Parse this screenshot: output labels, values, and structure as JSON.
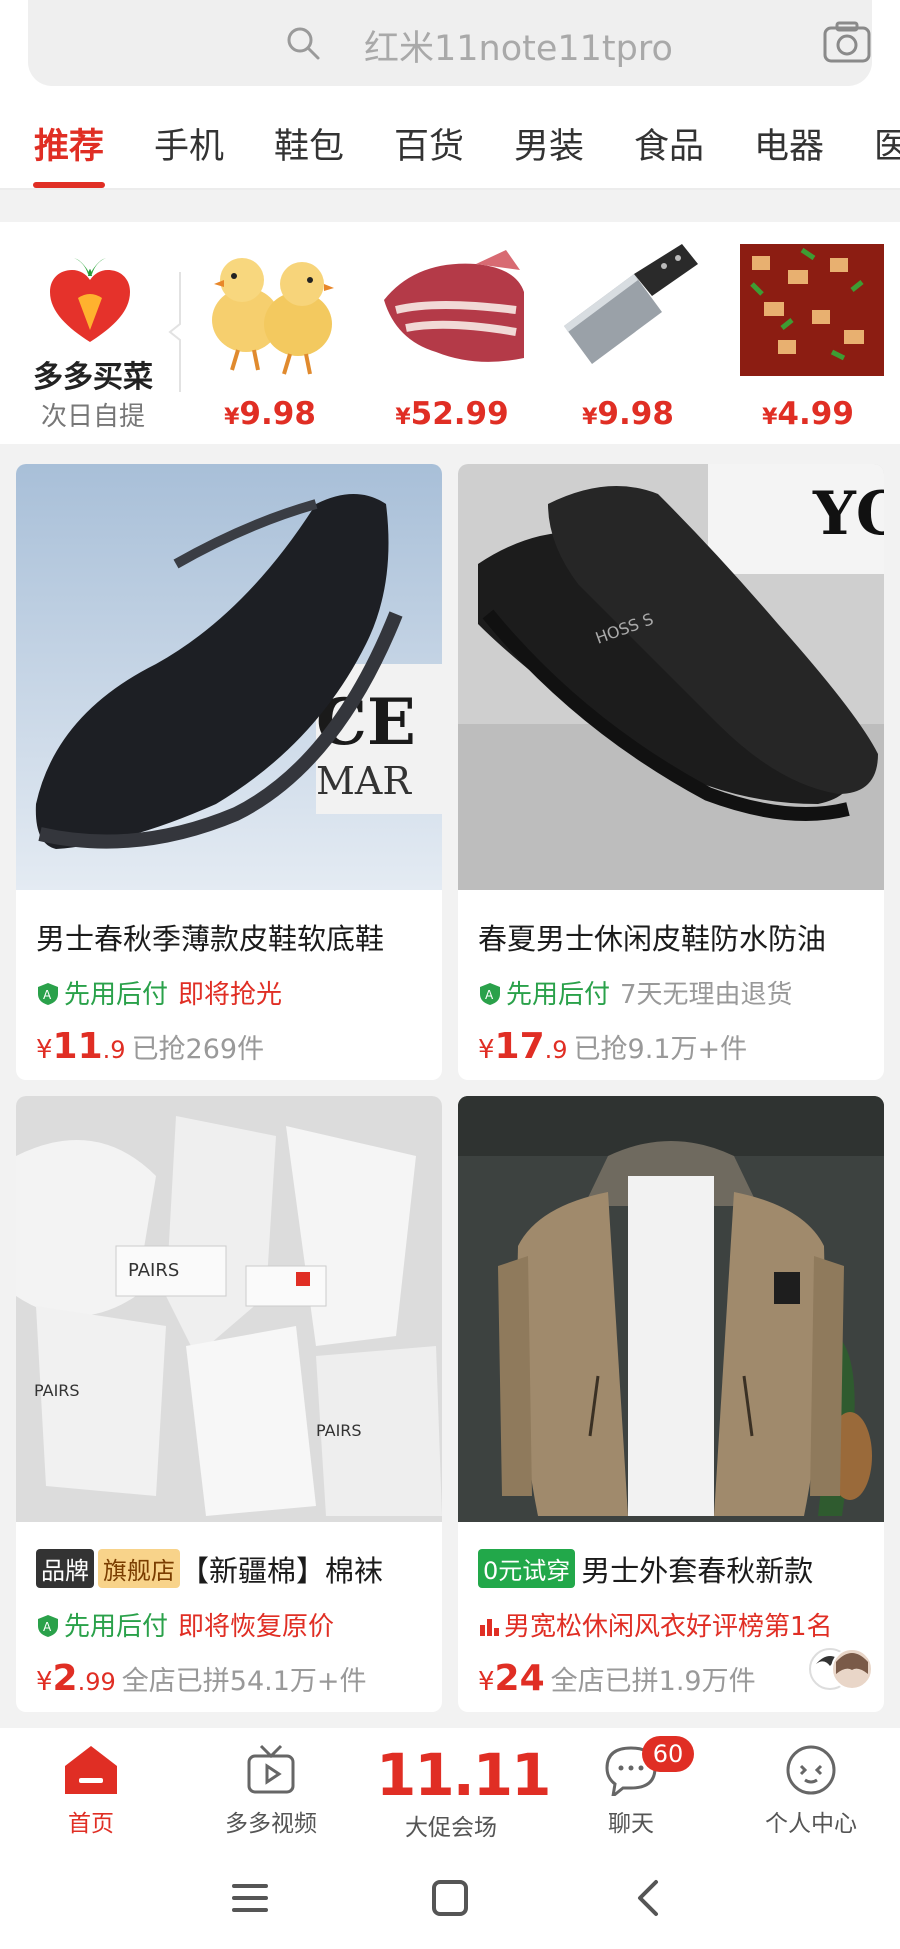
{
  "search": {
    "placeholder": "红米11note11tpro",
    "icon": "search-icon",
    "camera_icon": "camera-icon"
  },
  "tabs": [
    "推荐",
    "手机",
    "鞋包",
    "百货",
    "男装",
    "食品",
    "电器",
    "医"
  ],
  "active_tab": "推荐",
  "grocery": {
    "title": "多多买菜",
    "subtitle": "次日自提",
    "items": [
      {
        "image": "chicks",
        "currency": "¥",
        "price": "9.98"
      },
      {
        "image": "lamb-ribs",
        "currency": "¥",
        "price": "52.99"
      },
      {
        "image": "cleaver-knife",
        "currency": "¥",
        "price": "9.98"
      },
      {
        "image": "spicy-dish",
        "currency": "¥",
        "price": "4.99"
      }
    ]
  },
  "products": [
    {
      "title": "男士春秋季薄款皮鞋软底鞋",
      "pay_later": "先用后付",
      "tag": "即将抢光",
      "currency": "¥",
      "price_int": "11",
      "price_dec": ".9",
      "sold": "已抢269件"
    },
    {
      "title": "春夏男士休闲皮鞋防水防油",
      "pay_later": "先用后付",
      "tag": "7天无理由退货",
      "currency": "¥",
      "price_int": "17",
      "price_dec": ".9",
      "sold": "已抢9.1万+件"
    },
    {
      "badge1": "品牌",
      "badge2": "旗舰店",
      "title": "【新疆棉】棉袜",
      "pay_later": "先用后付",
      "tag": "即将恢复原价",
      "currency": "¥",
      "price_int": "2",
      "price_dec": ".99",
      "sold": "全店已拼54.1万+件"
    },
    {
      "badge1": "0元试穿",
      "title": "男士外套春秋新款",
      "rank": "男宽松休闲风衣好评榜第1名",
      "currency": "¥",
      "price_int": "24",
      "price_dec": "",
      "sold": "全店已拼1.9万件"
    }
  ],
  "bottom_nav": {
    "home": "首页",
    "video": "多多视频",
    "promo_big": "11.11",
    "promo": "大促会场",
    "chat": "聊天",
    "chat_badge": "60",
    "profile": "个人中心"
  },
  "colors": {
    "accent": "#e02e24",
    "green": "#2aa14a"
  }
}
